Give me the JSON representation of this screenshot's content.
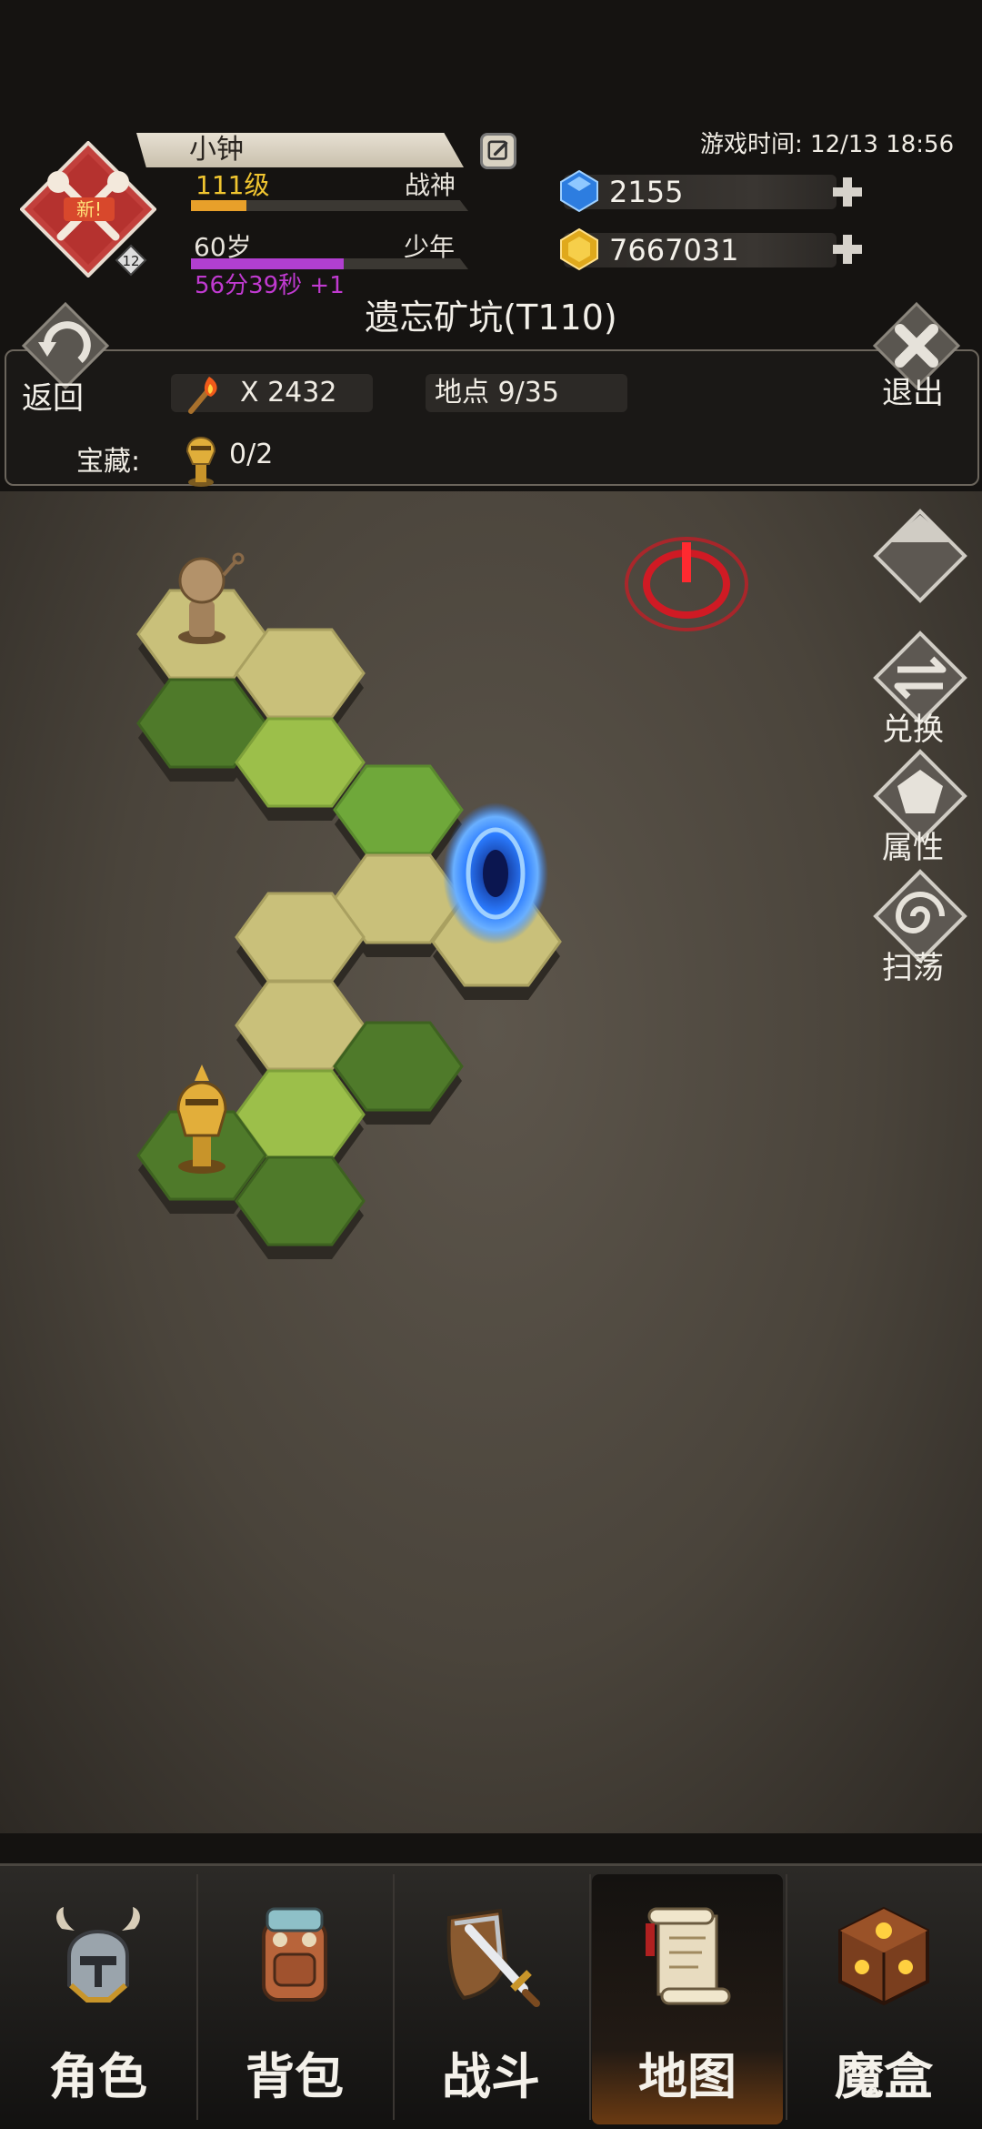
{
  "player": {
    "name": "小钟",
    "level": "111级",
    "rank": "战神",
    "age": "60岁",
    "life_stage": "少年",
    "timer": "56分39秒 +1",
    "emblem_badge": "新!",
    "emblem_number": "12",
    "level_progress": 0.2,
    "age_progress": 0.55
  },
  "game_time": "游戏时间: 12/13 18:56",
  "resources": {
    "diamonds": "2155",
    "gold": "7667031"
  },
  "map": {
    "title": "遗忘矿坑(T110)",
    "back_label": "返回",
    "exit_label": "退出",
    "torch_count": "X 2432",
    "location": "地点 9/35",
    "treasure_label": "宝藏:",
    "treasure_count": "0/2"
  },
  "side_buttons": {
    "exchange": "兑换",
    "attributes": "属性",
    "sweep": "扫荡"
  },
  "nav": {
    "items": [
      {
        "label": "角色",
        "icon": "helmet-icon"
      },
      {
        "label": "背包",
        "icon": "backpack-icon"
      },
      {
        "label": "战斗",
        "icon": "sword-shield-icon"
      },
      {
        "label": "地图",
        "icon": "scroll-map-icon"
      },
      {
        "label": "魔盒",
        "icon": "magic-box-icon"
      }
    ],
    "active_index": 3
  },
  "colors": {
    "level_text": "#f0c530",
    "timer_text": "#c03ad0",
    "age_bar": "#b13fd0",
    "level_bar": "#e8a02a",
    "emblem": "#c2403c",
    "portal": "#2a7bff",
    "alert": "#d01a24"
  }
}
